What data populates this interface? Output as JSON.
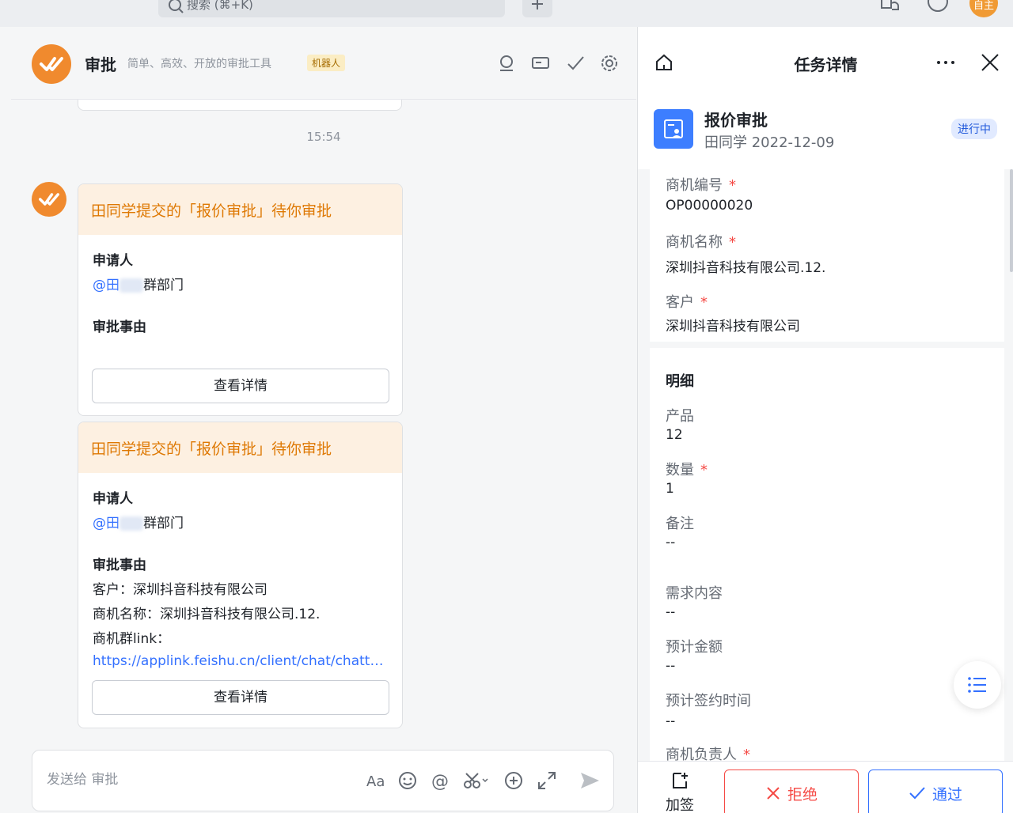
{
  "topbar": {
    "search_placeholder": "搜索 (⌘+K)",
    "avatar_text": "自主"
  },
  "chat": {
    "bot_name": "审批",
    "bot_desc": "简单、高效、开放的审批工具",
    "bot_tag": "机器人",
    "timestamp": "15:54",
    "cards": [
      {
        "title": "田同学提交的「报价审批」待你审批",
        "applicant_label": "申请人",
        "mention_prefix": "@田",
        "dept": "群部门",
        "reason_label": "审批事由",
        "button": "查看详情"
      },
      {
        "title": "田同学提交的「报价审批」待你审批",
        "applicant_label": "申请人",
        "mention_prefix": "@田",
        "dept": "群部门",
        "reason_label": "审批事由",
        "lines": [
          "客户：深圳抖音科技有限公司",
          "商机名称：深圳抖音科技有限公司.12.",
          "商机群link："
        ],
        "link": "https://applink.feishu.cn/client/chat/chatter/add_by_link?link_token=",
        "button": "查看详情"
      }
    ],
    "composer_placeholder": "发送给 审批"
  },
  "panel": {
    "title": "任务详情",
    "task_title": "报价审批",
    "task_sub": "田同学 2022-12-09",
    "status": "进行中",
    "fields_top": [
      {
        "label": "商机编号",
        "value": "OP00000020",
        "required": true
      },
      {
        "label": "商机名称",
        "value": "深圳抖音科技有限公司.12.",
        "required": true
      },
      {
        "label": "客户",
        "value": "深圳抖音科技有限公司",
        "required": true
      }
    ],
    "detail_title": "明细",
    "fields_detail": [
      {
        "label": "产品",
        "value": "12",
        "required": false
      },
      {
        "label": "数量",
        "value": "1",
        "required": true
      },
      {
        "label": "备注",
        "value": "--",
        "required": false
      },
      {
        "label": "需求内容",
        "value": "--",
        "required": false
      },
      {
        "label": "预计金额",
        "value": "--",
        "required": false
      },
      {
        "label": "预计签约时间",
        "value": "--",
        "required": false
      },
      {
        "label": "商机负责人",
        "value": "",
        "required": true
      }
    ],
    "add_sign": "加签",
    "reject": "拒绝",
    "pass": "通过",
    "req_mark": "*"
  }
}
